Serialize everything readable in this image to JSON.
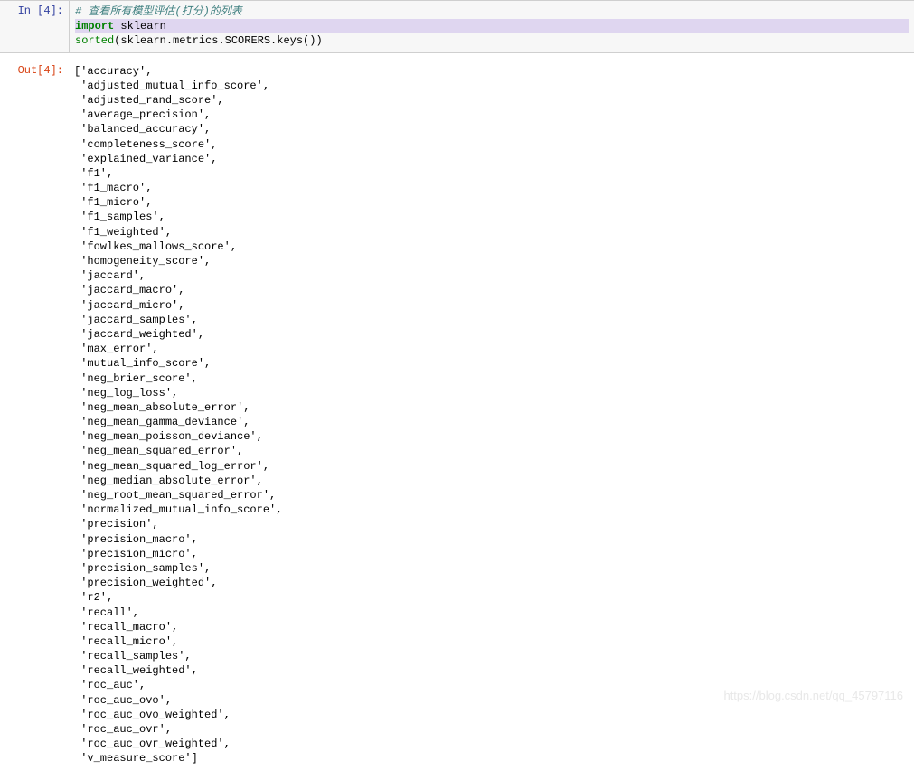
{
  "input": {
    "prompt": "In  [4]:",
    "code": {
      "comment": "# 查看所有模型评估(打分)的列表",
      "line2_kw": "import",
      "line2_mod": " sklearn",
      "line3_fn": "sorted",
      "line3_rest": "(sklearn.metrics.SCORERS.keys())"
    }
  },
  "output": {
    "prompt": "Out[4]:",
    "items": [
      "accuracy",
      "adjusted_mutual_info_score",
      "adjusted_rand_score",
      "average_precision",
      "balanced_accuracy",
      "completeness_score",
      "explained_variance",
      "f1",
      "f1_macro",
      "f1_micro",
      "f1_samples",
      "f1_weighted",
      "fowlkes_mallows_score",
      "homogeneity_score",
      "jaccard",
      "jaccard_macro",
      "jaccard_micro",
      "jaccard_samples",
      "jaccard_weighted",
      "max_error",
      "mutual_info_score",
      "neg_brier_score",
      "neg_log_loss",
      "neg_mean_absolute_error",
      "neg_mean_gamma_deviance",
      "neg_mean_poisson_deviance",
      "neg_mean_squared_error",
      "neg_mean_squared_log_error",
      "neg_median_absolute_error",
      "neg_root_mean_squared_error",
      "normalized_mutual_info_score",
      "precision",
      "precision_macro",
      "precision_micro",
      "precision_samples",
      "precision_weighted",
      "r2",
      "recall",
      "recall_macro",
      "recall_micro",
      "recall_samples",
      "recall_weighted",
      "roc_auc",
      "roc_auc_ovo",
      "roc_auc_ovo_weighted",
      "roc_auc_ovr",
      "roc_auc_ovr_weighted",
      "v_measure_score"
    ]
  },
  "watermark": "https://blog.csdn.net/qq_45797116"
}
